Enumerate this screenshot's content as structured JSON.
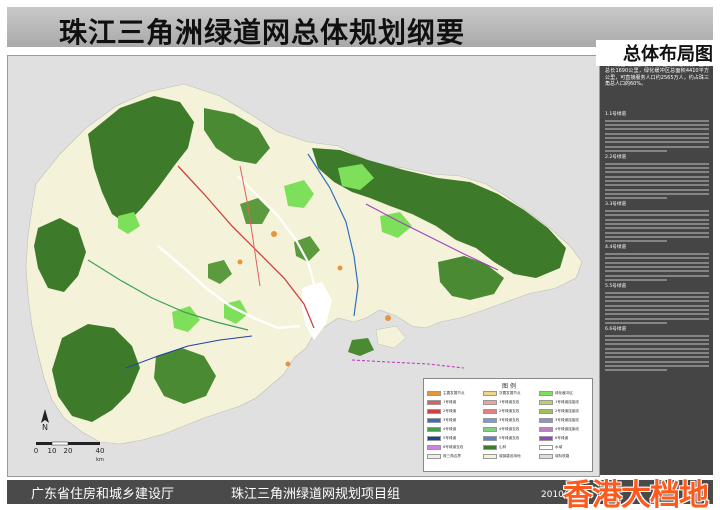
{
  "header": {
    "title": "珠江三角洲绿道网总体规划纲要"
  },
  "side": {
    "title": "总体布局图",
    "intro": "珠三角区域绿道网由六条区域绿道构成，主线总长1690公里，绿化缓冲区总面积4410平方公里，可直接服务人口约2565万人，约占珠三角总人口的60%。",
    "sections": [
      {
        "head": "1.1号绿道",
        "lines": 8
      },
      {
        "head": "2.2号绿道",
        "lines": 9
      },
      {
        "head": "3.3号绿道",
        "lines": 8
      },
      {
        "head": "4.4号绿道",
        "lines": 7
      },
      {
        "head": "5.5号绿道",
        "lines": 8
      },
      {
        "head": "6.6号绿道",
        "lines": 9
      }
    ]
  },
  "map": {
    "colors": {
      "background": "#e0e0e0",
      "land": "#f4f3d9",
      "forest": "#3d7a2a",
      "greenway_zone": "#7ee05a",
      "water": "#ffffff"
    },
    "north_label": "N",
    "scale": {
      "ticks": [
        "0",
        "10",
        "20",
        "40"
      ],
      "unit": "km"
    }
  },
  "legend": {
    "title": "图 例",
    "items": [
      {
        "label": "主要发展节点",
        "color": "#e8943a"
      },
      {
        "label": "次要发展节点",
        "color": "#f2d38a"
      },
      {
        "label": "绿化缓冲区",
        "color": "#7ee05a"
      },
      {
        "label": "1号绿道",
        "color": "#e06060"
      },
      {
        "label": "1号绿道支线",
        "color": "#f0a0a0"
      },
      {
        "label": "1号绿道连接线",
        "color": "#c0d060"
      },
      {
        "label": "2号绿道",
        "color": "#d04040"
      },
      {
        "label": "2号绿道支线",
        "color": "#e08080"
      },
      {
        "label": "2号绿道连接线",
        "color": "#a0c060"
      },
      {
        "label": "3号绿道",
        "color": "#3070c0"
      },
      {
        "label": "3号绿道支线",
        "color": "#70a0e0"
      },
      {
        "label": "3号绿道连接线",
        "color": "#9090d0"
      },
      {
        "label": "4号绿道",
        "color": "#40a050"
      },
      {
        "label": "4号绿道支线",
        "color": "#80d080"
      },
      {
        "label": "4号绿道连接线",
        "color": "#c080c0"
      },
      {
        "label": "5号绿道",
        "color": "#2040a0"
      },
      {
        "label": "5号绿道支线",
        "color": "#6080d0"
      },
      {
        "label": "6号绿道",
        "color": "#a040c0"
      },
      {
        "label": "6号绿道支线",
        "color": "#d080e0"
      },
      {
        "label": "山林",
        "color": "#3d7a2a"
      },
      {
        "label": "水域",
        "color": "#ffffff"
      },
      {
        "label": "珠三角边界",
        "color": "#eeeeee"
      },
      {
        "label": "城镇建设用地",
        "color": "#f4f3d9"
      },
      {
        "label": "城际铁路",
        "color": "#dddddd"
      }
    ]
  },
  "footer": {
    "org": "广东省住房和城乡建设厅",
    "project": "珠江三角洲绿道网规划项目组",
    "date": "2010年"
  },
  "watermark": {
    "text": "香港大档地"
  }
}
